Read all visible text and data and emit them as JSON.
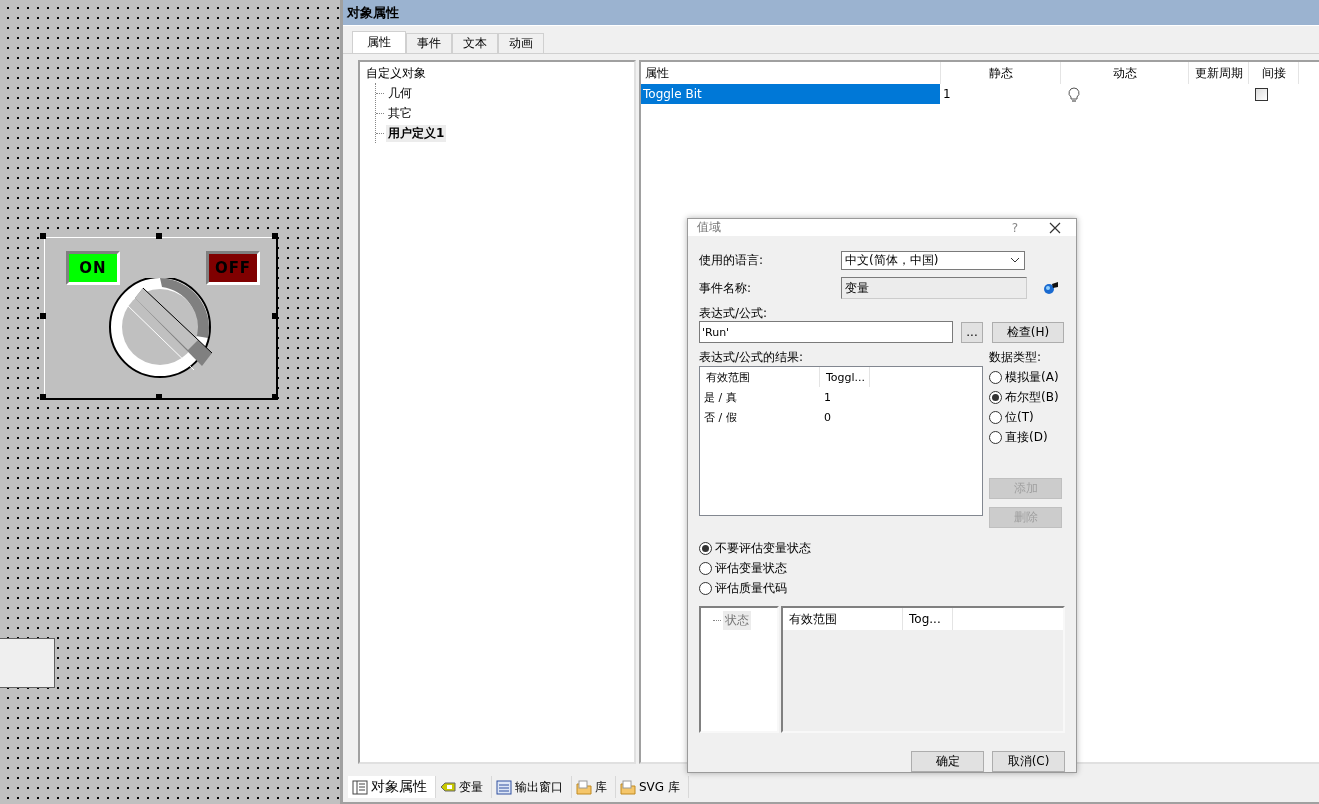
{
  "canvas": {
    "switch_object": {
      "selected": true,
      "on_label": "ON",
      "off_label": "OFF"
    }
  },
  "panel": {
    "title": "对象属性",
    "tabs": [
      {
        "label": "属性",
        "selected": true
      },
      {
        "label": "事件",
        "selected": false
      },
      {
        "label": "文本",
        "selected": false
      },
      {
        "label": "动画",
        "selected": false
      }
    ],
    "tree": {
      "label": "自定义对象",
      "children": [
        {
          "label": "几何",
          "selected": false
        },
        {
          "label": "其它",
          "selected": false
        },
        {
          "label": "用户定义1",
          "selected": true
        }
      ]
    },
    "table": {
      "columns": [
        "属性",
        "静态",
        "动态",
        "更新周期",
        "间接"
      ],
      "rows": [
        {
          "name": "Toggle Bit",
          "static": "1",
          "selected": true,
          "indirect": false
        }
      ]
    },
    "bottom_tabs": [
      {
        "label": "对象属性",
        "kind": "properties",
        "selected": true
      },
      {
        "label": "变量",
        "kind": "tag",
        "selected": false
      },
      {
        "label": "输出窗口",
        "kind": "window",
        "selected": false
      },
      {
        "label": "库",
        "kind": "folder",
        "selected": false
      },
      {
        "label": "SVG 库",
        "kind": "folder",
        "selected": false
      }
    ]
  },
  "dialog": {
    "title": "值域",
    "help": "?",
    "language": {
      "label": "使用的语言:",
      "value": "中文(简体，中国)"
    },
    "event_name": {
      "label": "事件名称:",
      "value": "变量"
    },
    "expression": {
      "label": "表达式/公式:",
      "value": "'Run'",
      "browse": "...",
      "check": "检查(H)"
    },
    "result": {
      "label": "表达式/公式的结果:",
      "columns": [
        "有效范围",
        "Toggl..."
      ],
      "rows": [
        [
          "是 / 真",
          "1"
        ],
        [
          "否 / 假",
          "0"
        ]
      ]
    },
    "data_type": {
      "label": "数据类型:",
      "options": [
        {
          "label": "模拟量(A)",
          "selected": false
        },
        {
          "label": "布尔型(B)",
          "selected": true
        },
        {
          "label": "位(T)",
          "selected": false
        },
        {
          "label": "直接(D)",
          "selected": false
        }
      ]
    },
    "side_buttons": [
      {
        "label": "添加",
        "disabled": true
      },
      {
        "label": "删除",
        "disabled": true
      }
    ],
    "evaluation": [
      {
        "label": "不要评估变量状态",
        "selected": true
      },
      {
        "label": "评估变量状态",
        "selected": false
      },
      {
        "label": "评估质量代码",
        "selected": false
      }
    ],
    "status_tree": {
      "label": "状态"
    },
    "status_table": {
      "columns": [
        "有效范围",
        "Tog..."
      ]
    },
    "buttons": [
      "确定",
      "取消(C)"
    ]
  }
}
